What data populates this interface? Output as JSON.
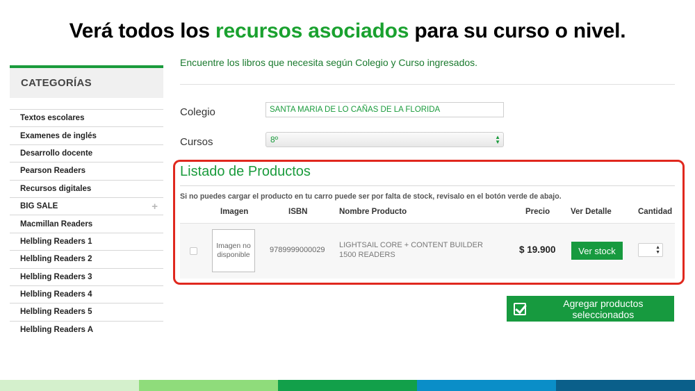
{
  "headline": {
    "pre": "Verá todos los ",
    "highlight": "recursos asociados",
    "post": " para su curso o nivel."
  },
  "sidebar": {
    "title": "CATEGORÍAS",
    "items": [
      {
        "label": "Textos escolares"
      },
      {
        "label": "Examenes de inglés"
      },
      {
        "label": "Desarrollo docente"
      },
      {
        "label": "Pearson Readers"
      },
      {
        "label": "Recursos digitales"
      },
      {
        "label": "BIG SALE",
        "expand": "+"
      },
      {
        "label": "Macmillan Readers"
      },
      {
        "label": "Helbling Readers 1"
      },
      {
        "label": "Helbling Readers 2"
      },
      {
        "label": "Helbling Readers 3"
      },
      {
        "label": "Helbling Readers 4"
      },
      {
        "label": "Helbling Readers 5"
      },
      {
        "label": "Helbling Readers A"
      }
    ]
  },
  "intro": "Encuentre los libros que necesita según Colegio y Curso ingresados.",
  "form": {
    "colegio_label": "Colegio",
    "colegio_value": "SANTA MARIA DE LO CAÑAS DE LA FLORIDA",
    "cursos_label": "Cursos",
    "curso_value": "8º"
  },
  "products": {
    "title": "Listado de Productos",
    "warning": "Si no puedes cargar el producto en tu carro puede ser por falta de stock, revisalo en el botón verde de abajo.",
    "headers": {
      "imagen": "Imagen",
      "isbn": "ISBN",
      "nombre": "Nombre Producto",
      "precio": "Precio",
      "detalle": "Ver Detalle",
      "cantidad": "Cantidad"
    },
    "row": {
      "image_placeholder": "Imagen no disponible",
      "isbn": "9789999000029",
      "name": "LIGHTSAIL CORE + CONTENT BUILDER 1500 READERS",
      "price": "$ 19.900",
      "detail_button": "Ver stock"
    },
    "add_button": "Agregar productos seleccionados"
  },
  "colors": {
    "accent_green": "#1a9b3c",
    "highlight_red": "#e0281e",
    "footer": [
      "#d4f0cc",
      "#8fdc7b",
      "#12a04a",
      "#0a8ec8",
      "#0a5f8a"
    ]
  }
}
